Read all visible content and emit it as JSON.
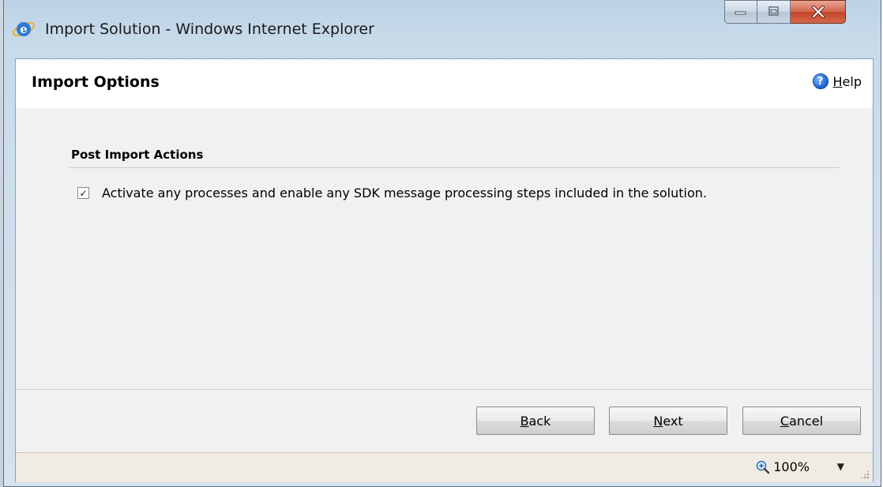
{
  "window": {
    "title": "Import Solution - Windows Internet Explorer"
  },
  "header": {
    "title": "Import Options",
    "help_label_accel": "H",
    "help_label_rest": "elp"
  },
  "section": {
    "title": "Post Import Actions",
    "checkbox_label": "Activate any processes and enable any SDK message processing steps included in the solution.",
    "checkbox_checked": true,
    "check_glyph": "✓"
  },
  "footer": {
    "buttons": [
      {
        "accel": "B",
        "rest": "ack"
      },
      {
        "accel": "N",
        "rest": "ext"
      },
      {
        "accel": "C",
        "rest": "ancel"
      }
    ]
  },
  "statusbar": {
    "zoom": "100%",
    "zoom_arrow": "▼"
  },
  "colors": {
    "title_bar": "#c9dbea",
    "close_button": "#c2452a",
    "body_bg": "#f1f1f1",
    "statusbar_bg": "#f0ece3"
  },
  "icons": {
    "app_icon": "ie-logo-icon",
    "help_icon": "help-question-icon",
    "zoom_icon": "zoom-magnifier-icon"
  }
}
